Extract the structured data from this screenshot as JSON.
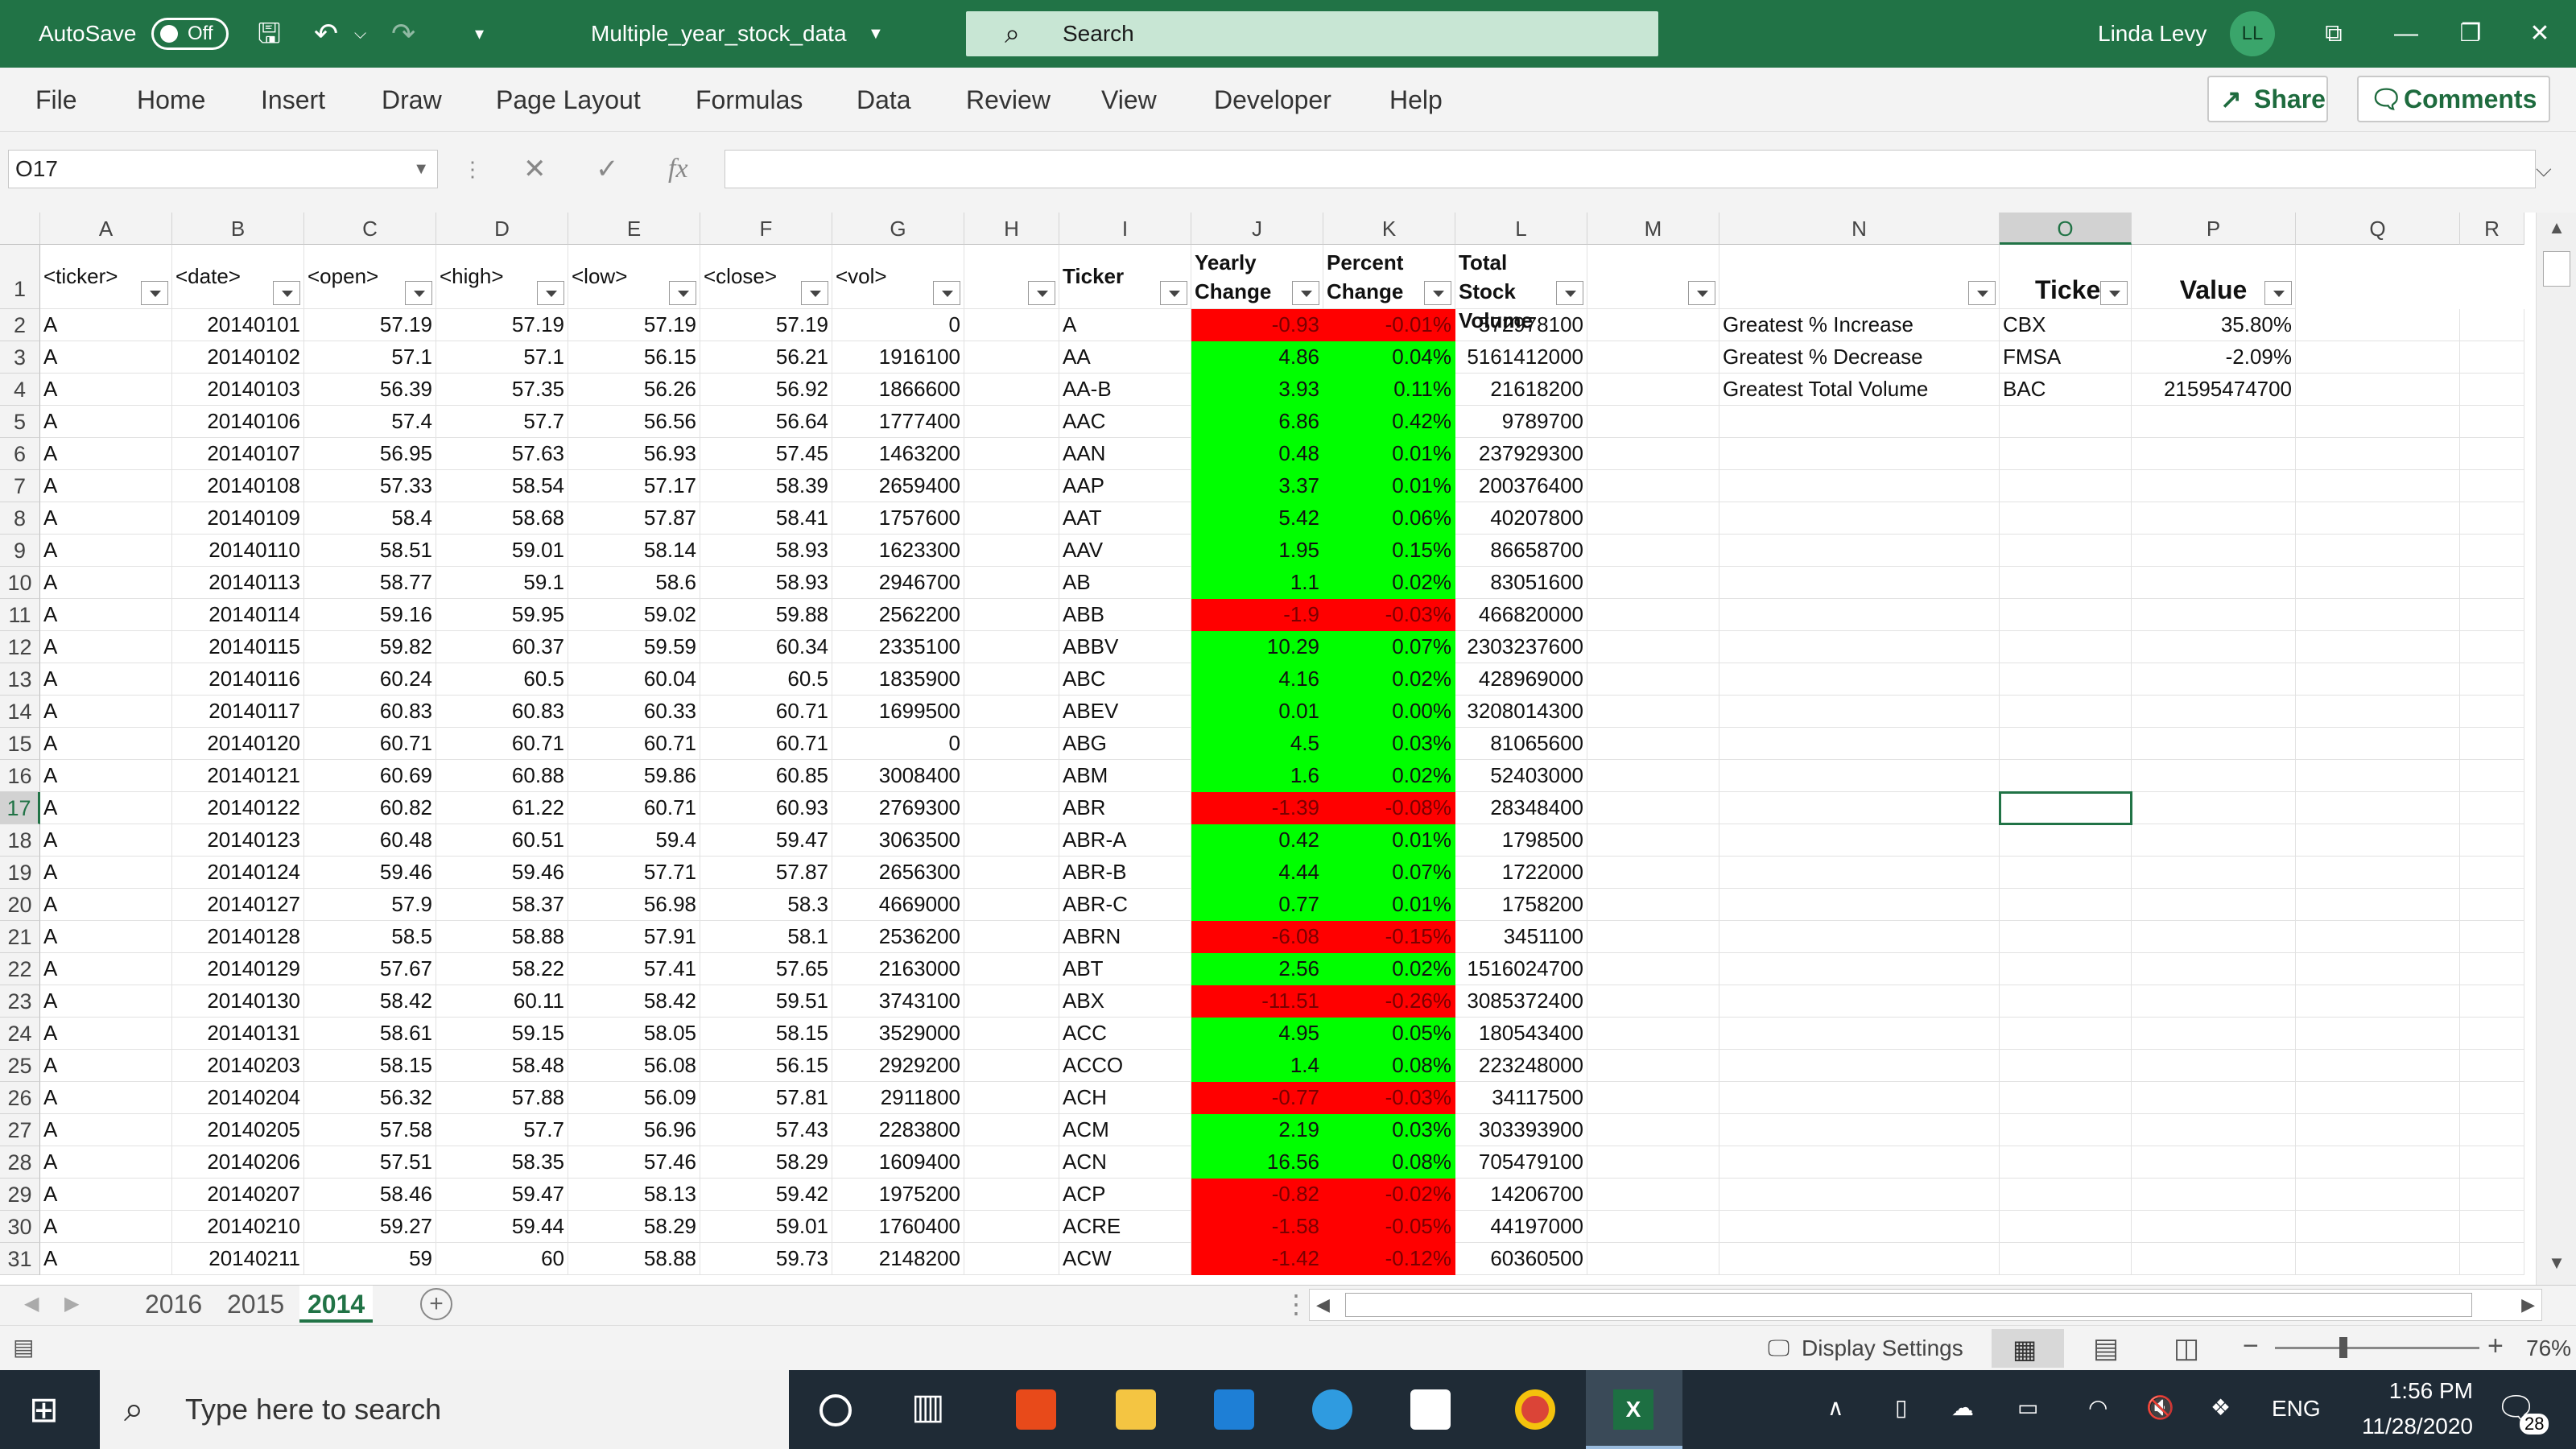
{
  "titlebar": {
    "autosave_label": "AutoSave",
    "autosave_state": "Off",
    "filename": "Multiple_year_stock_data",
    "search_placeholder": "Search",
    "user_name": "Linda Levy",
    "user_initials": "LL"
  },
  "ribbon": {
    "tabs": [
      "File",
      "Home",
      "Insert",
      "Draw",
      "Page Layout",
      "Formulas",
      "Data",
      "Review",
      "View",
      "Developer",
      "Help"
    ],
    "share_label": "Share",
    "comments_label": "Comments"
  },
  "formula_bar": {
    "name_box": "O17",
    "fx": "fx",
    "content": ""
  },
  "columns": [
    "A",
    "B",
    "C",
    "D",
    "E",
    "F",
    "G",
    "H",
    "I",
    "J",
    "K",
    "L",
    "M",
    "N",
    "O",
    "P",
    "Q",
    "R"
  ],
  "headers": {
    "A": "<ticker>",
    "B": "<date>",
    "C": "<open>",
    "D": "<high>",
    "E": "<low>",
    "F": "<close>",
    "G": "<vol>",
    "I": "Ticker",
    "J": "Yearly Change",
    "K": "Percent Change",
    "L": "Total Stock Volume",
    "O": "Ticker",
    "P": "Value"
  },
  "rows": [
    [
      "A",
      "20140101",
      "57.19",
      "57.19",
      "57.19",
      "57.19",
      "0",
      "A",
      "-0.93",
      "-0.01%",
      "572978100"
    ],
    [
      "A",
      "20140102",
      "57.1",
      "57.1",
      "56.15",
      "56.21",
      "1916100",
      "AA",
      "4.86",
      "0.04%",
      "5161412000"
    ],
    [
      "A",
      "20140103",
      "56.39",
      "57.35",
      "56.26",
      "56.92",
      "1866600",
      "AA-B",
      "3.93",
      "0.11%",
      "21618200"
    ],
    [
      "A",
      "20140106",
      "57.4",
      "57.7",
      "56.56",
      "56.64",
      "1777400",
      "AAC",
      "6.86",
      "0.42%",
      "9789700"
    ],
    [
      "A",
      "20140107",
      "56.95",
      "57.63",
      "56.93",
      "57.45",
      "1463200",
      "AAN",
      "0.48",
      "0.01%",
      "237929300"
    ],
    [
      "A",
      "20140108",
      "57.33",
      "58.54",
      "57.17",
      "58.39",
      "2659400",
      "AAP",
      "3.37",
      "0.01%",
      "200376400"
    ],
    [
      "A",
      "20140109",
      "58.4",
      "58.68",
      "57.87",
      "58.41",
      "1757600",
      "AAT",
      "5.42",
      "0.06%",
      "40207800"
    ],
    [
      "A",
      "20140110",
      "58.51",
      "59.01",
      "58.14",
      "58.93",
      "1623300",
      "AAV",
      "1.95",
      "0.15%",
      "86658700"
    ],
    [
      "A",
      "20140113",
      "58.77",
      "59.1",
      "58.6",
      "58.93",
      "2946700",
      "AB",
      "1.1",
      "0.02%",
      "83051600"
    ],
    [
      "A",
      "20140114",
      "59.16",
      "59.95",
      "59.02",
      "59.88",
      "2562200",
      "ABB",
      "-1.9",
      "-0.03%",
      "466820000"
    ],
    [
      "A",
      "20140115",
      "59.82",
      "60.37",
      "59.59",
      "60.34",
      "2335100",
      "ABBV",
      "10.29",
      "0.07%",
      "2303237600"
    ],
    [
      "A",
      "20140116",
      "60.24",
      "60.5",
      "60.04",
      "60.5",
      "1835900",
      "ABC",
      "4.16",
      "0.02%",
      "428969000"
    ],
    [
      "A",
      "20140117",
      "60.83",
      "60.83",
      "60.33",
      "60.71",
      "1699500",
      "ABEV",
      "0.01",
      "0.00%",
      "3208014300"
    ],
    [
      "A",
      "20140120",
      "60.71",
      "60.71",
      "60.71",
      "60.71",
      "0",
      "ABG",
      "4.5",
      "0.03%",
      "81065600"
    ],
    [
      "A",
      "20140121",
      "60.69",
      "60.88",
      "59.86",
      "60.85",
      "3008400",
      "ABM",
      "1.6",
      "0.02%",
      "52403000"
    ],
    [
      "A",
      "20140122",
      "60.82",
      "61.22",
      "60.71",
      "60.93",
      "2769300",
      "ABR",
      "-1.39",
      "-0.08%",
      "28348400"
    ],
    [
      "A",
      "20140123",
      "60.48",
      "60.51",
      "59.4",
      "59.47",
      "3063500",
      "ABR-A",
      "0.42",
      "0.01%",
      "1798500"
    ],
    [
      "A",
      "20140124",
      "59.46",
      "59.46",
      "57.71",
      "57.87",
      "2656300",
      "ABR-B",
      "4.44",
      "0.07%",
      "1722000"
    ],
    [
      "A",
      "20140127",
      "57.9",
      "58.37",
      "56.98",
      "58.3",
      "4669000",
      "ABR-C",
      "0.77",
      "0.01%",
      "1758200"
    ],
    [
      "A",
      "20140128",
      "58.5",
      "58.88",
      "57.91",
      "58.1",
      "2536200",
      "ABRN",
      "-6.08",
      "-0.15%",
      "3451100"
    ],
    [
      "A",
      "20140129",
      "57.67",
      "58.22",
      "57.41",
      "57.65",
      "2163000",
      "ABT",
      "2.56",
      "0.02%",
      "1516024700"
    ],
    [
      "A",
      "20140130",
      "58.42",
      "60.11",
      "58.42",
      "59.51",
      "3743100",
      "ABX",
      "-11.51",
      "-0.26%",
      "3085372400"
    ],
    [
      "A",
      "20140131",
      "58.61",
      "59.15",
      "58.05",
      "58.15",
      "3529000",
      "ACC",
      "4.95",
      "0.05%",
      "180543400"
    ],
    [
      "A",
      "20140203",
      "58.15",
      "58.48",
      "56.08",
      "56.15",
      "2929200",
      "ACCO",
      "1.4",
      "0.08%",
      "223248000"
    ],
    [
      "A",
      "20140204",
      "56.32",
      "57.88",
      "56.09",
      "57.81",
      "2911800",
      "ACH",
      "-0.77",
      "-0.03%",
      "34117500"
    ],
    [
      "A",
      "20140205",
      "57.58",
      "57.7",
      "56.96",
      "57.43",
      "2283800",
      "ACM",
      "2.19",
      "0.03%",
      "303393900"
    ],
    [
      "A",
      "20140206",
      "57.51",
      "58.35",
      "57.46",
      "58.29",
      "1609400",
      "ACN",
      "16.56",
      "0.08%",
      "705479100"
    ],
    [
      "A",
      "20140207",
      "58.46",
      "59.47",
      "58.13",
      "59.42",
      "1975200",
      "ACP",
      "-0.82",
      "-0.02%",
      "14206700"
    ],
    [
      "A",
      "20140210",
      "59.27",
      "59.44",
      "58.29",
      "59.01",
      "1760400",
      "ACRE",
      "-1.58",
      "-0.05%",
      "44197000"
    ],
    [
      "A",
      "20140211",
      "59",
      "60",
      "58.88",
      "59.73",
      "2148200",
      "ACW",
      "-1.42",
      "-0.12%",
      "60360500"
    ]
  ],
  "summary": [
    [
      "Greatest % Increase",
      "CBX",
      "35.80%"
    ],
    [
      "Greatest % Decrease",
      "FMSA",
      "-2.09%"
    ],
    [
      "Greatest Total Volume",
      "BAC",
      "21595474700"
    ]
  ],
  "sheet_tabs": [
    "2016",
    "2015",
    "2014"
  ],
  "active_sheet": "2014",
  "status": {
    "display_settings": "Display Settings",
    "zoom": "76%"
  },
  "taskbar": {
    "search_placeholder": "Type here to search",
    "lang": "ENG",
    "time": "1:56 PM",
    "date": "11/28/2020",
    "notifications": "28"
  },
  "colors": {
    "excel_green": "#217346",
    "positive_fill": "#00ff00",
    "negative_fill": "#ff0000"
  }
}
